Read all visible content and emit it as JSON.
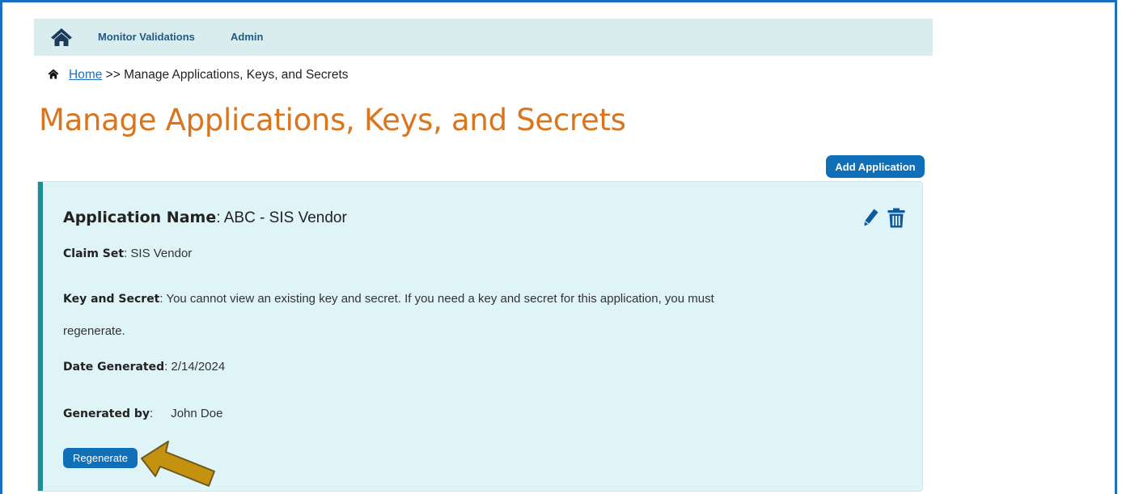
{
  "navbar": {
    "home_icon": "home-icon",
    "items": [
      {
        "label": "Monitor Validations"
      },
      {
        "label": "Admin"
      }
    ]
  },
  "breadcrumb": {
    "icon": "home-icon",
    "home_link": "Home",
    "separator_and_current": " >> Manage Applications, Keys, and Secrets"
  },
  "page": {
    "title": "Manage Applications, Keys, and Secrets",
    "add_button_label": "Add Application"
  },
  "application": {
    "name_label": "Application Name",
    "name_value": ": ABC - SIS Vendor",
    "claim_set_label": "Claim Set",
    "claim_set_value": ": SIS Vendor",
    "key_secret_label": "Key and Secret",
    "key_secret_value": ": You cannot view an existing key and secret. If you need a key and secret for this application, you must",
    "key_secret_value_cont": "regenerate.",
    "date_label": "Date Generated",
    "date_value": ": 2/14/2024",
    "generated_by_label": "Generated by",
    "generated_by_colon": ":",
    "generated_by_value": "John Doe",
    "regenerate_button_label": "Regenerate",
    "edit_icon": "pencil-icon",
    "delete_icon": "trash-icon"
  },
  "colors": {
    "accent": "#0f6fb8",
    "title": "#d9751f",
    "navbar_bg": "#d9ecee",
    "card_bg": "#dff4f6",
    "card_border": "#1f8f96",
    "callout_arrow": "#c4920f"
  }
}
